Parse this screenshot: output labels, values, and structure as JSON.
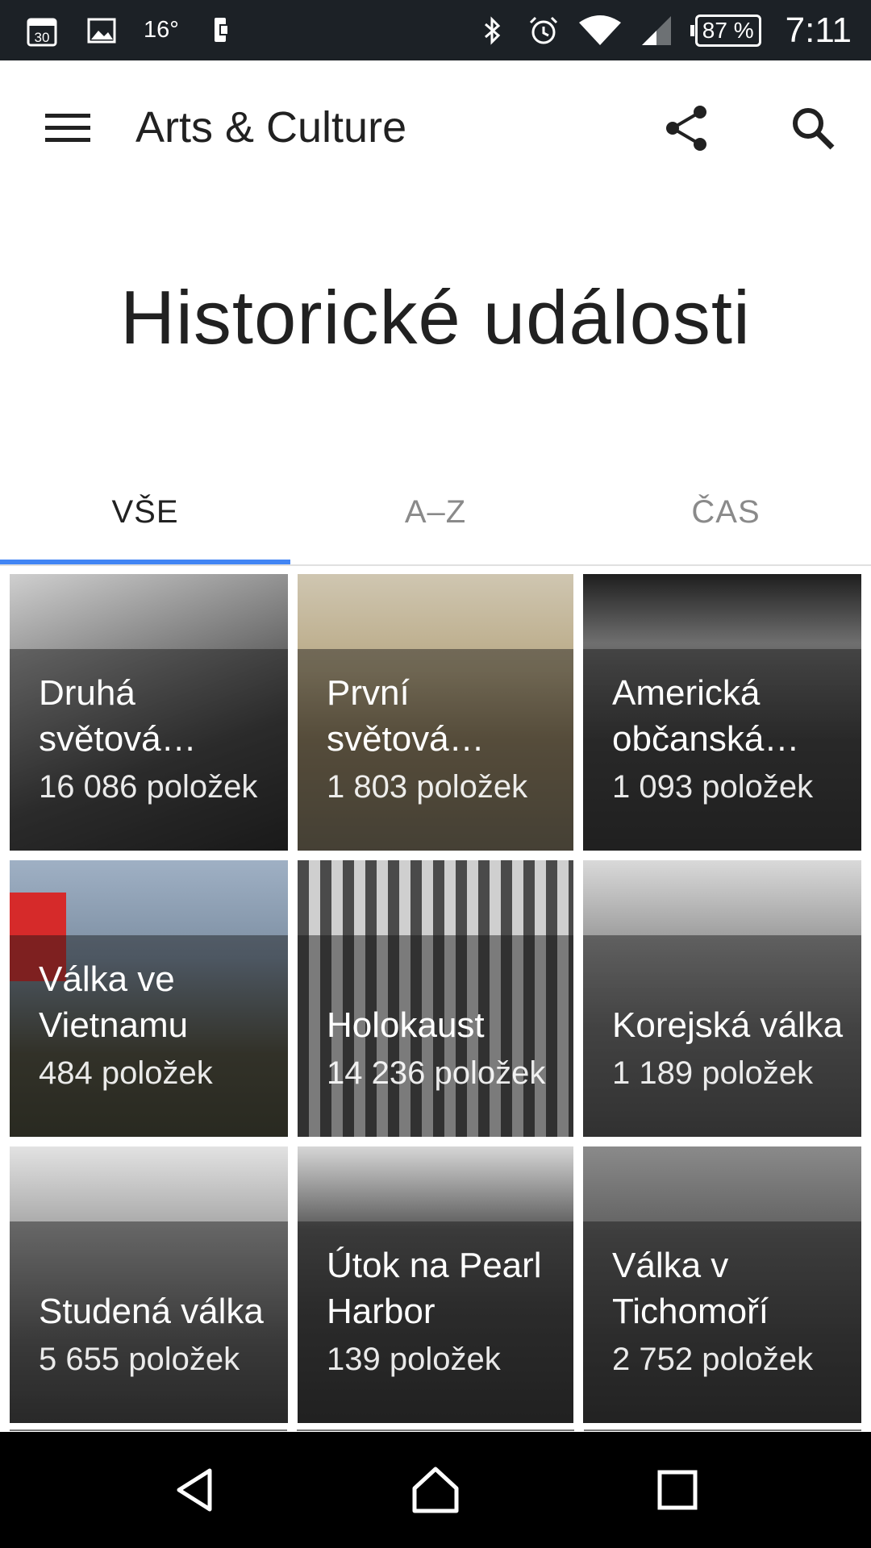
{
  "status_bar": {
    "calendar_day": "30",
    "temperature": "16°",
    "battery_percent": "87 %",
    "time": "7:11",
    "icons": [
      "calendar-icon",
      "gallery-icon",
      "temperature",
      "phone-vibrate-icon",
      "bluetooth-icon",
      "alarm-icon",
      "wifi-icon",
      "signal-icon",
      "battery-icon"
    ]
  },
  "app_bar": {
    "title": "Arts & Culture",
    "menu_icon": "menu-icon",
    "share_icon": "share-icon",
    "search_icon": "search-icon"
  },
  "page": {
    "title": "Historické události"
  },
  "tabs": [
    {
      "label": "VŠE",
      "active": true
    },
    {
      "label": "A–Z",
      "active": false
    },
    {
      "label": "ČAS",
      "active": false
    }
  ],
  "accent_color": "#4285f4",
  "tiles": [
    {
      "name": "Druhá světová…",
      "count": "16 086 položek"
    },
    {
      "name": "První světová…",
      "count": "1 803 položek"
    },
    {
      "name": "Americká občanská…",
      "count": "1 093 položek"
    },
    {
      "name": "Válka ve Vietnamu",
      "count": "484 položek"
    },
    {
      "name": "Holokaust",
      "count": "14 236 položek"
    },
    {
      "name": "Korejská válka",
      "count": "1 189 položek"
    },
    {
      "name": "Studená válka",
      "count": "5 655 položek"
    },
    {
      "name": "Útok na Pearl Harbor",
      "count": "139 položek"
    },
    {
      "name": "Válka v Tichomoří",
      "count": "2 752 položek"
    }
  ],
  "nav_bar": {
    "icons": [
      "back-icon",
      "home-icon",
      "recents-icon"
    ]
  }
}
